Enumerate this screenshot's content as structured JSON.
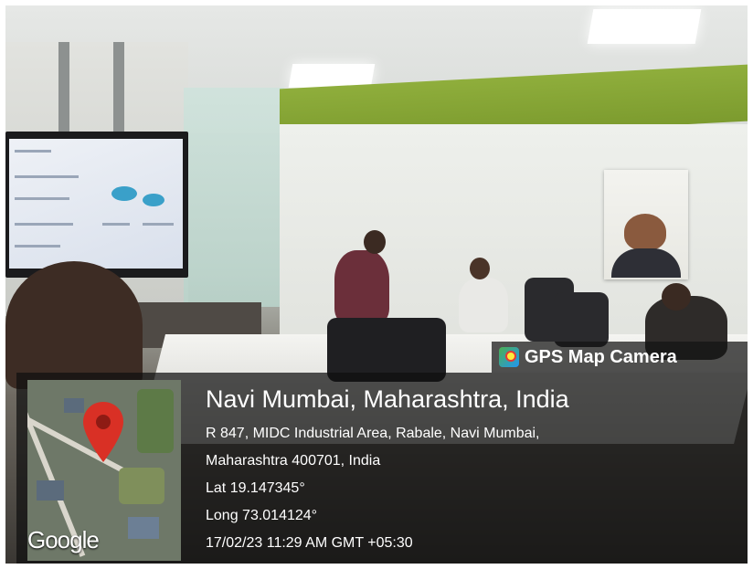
{
  "overlay": {
    "app_label": "GPS Map Camera",
    "place_title": "Navi Mumbai, Maharashtra, India",
    "address_line1": "R 847, MIDC Industrial Area, Rabale, Navi Mumbai,",
    "address_line2": "Maharashtra 400701, India",
    "latitude": "Lat 19.147345°",
    "longitude": "Long 73.014124°",
    "datetime": "17/02/23 11:29 AM GMT +05:30",
    "map_attribution": "Google",
    "app_icon": "map-camera-icon",
    "pin_icon": "location-pin-icon",
    "pin_color": "#d93025"
  }
}
